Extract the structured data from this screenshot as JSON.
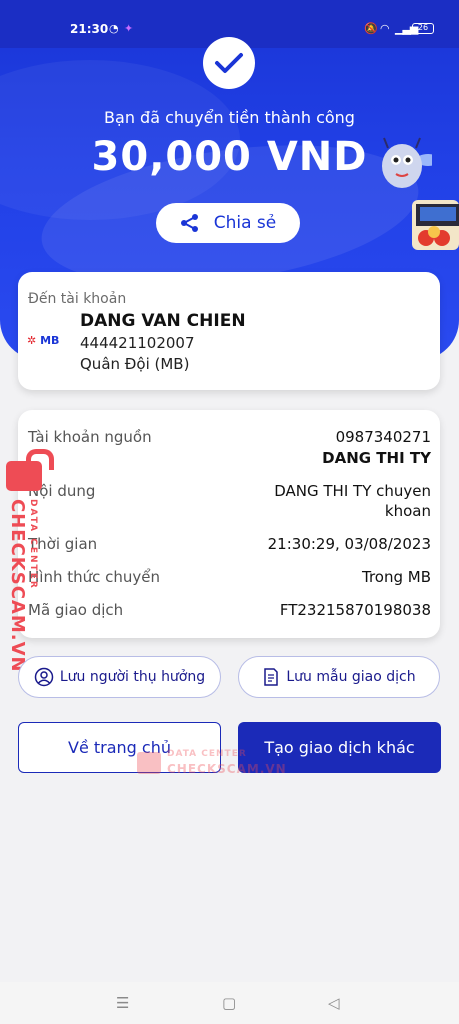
{
  "status_bar": {
    "time": "21:30",
    "battery": "26"
  },
  "hero": {
    "success_text": "Bạn đã chuyển tiền thành công",
    "amount": "30,000 VND",
    "share_label": "Chia sẻ",
    "colors": {
      "primary": "#1a35d6",
      "accent_red": "#ee4c55"
    }
  },
  "destination": {
    "label": "Đến tài khoản",
    "bank_logo": "MB",
    "name": "DANG VAN CHIEN",
    "account": "444421102007",
    "bank": "Quân Đội (MB)"
  },
  "details": {
    "source_label": "Tài khoản nguồn",
    "source_account": "0987340271",
    "source_name": "DANG THI TY",
    "content_label": "Nội dung",
    "content_line1": "DANG THI TY chuyen",
    "content_line2": "khoan",
    "time_label": "Thời gian",
    "time_value": "21:30:29, 03/08/2023",
    "method_label": "Hình thức chuyển",
    "method_value": "Trong MB",
    "txn_label": "Mã giao dịch",
    "txn_value": "FT23215870198038"
  },
  "actions": {
    "save_beneficiary": "Lưu người thụ hưởng",
    "save_template": "Lưu mẫu giao dịch",
    "home": "Về trang chủ",
    "new_transaction": "Tạo giao dịch khác"
  },
  "watermark": {
    "brand": "CHECKSCAM.VN",
    "sub": "DATA CENTER"
  },
  "nav": {
    "menu": "☰",
    "home": "▢",
    "back": "◁"
  }
}
